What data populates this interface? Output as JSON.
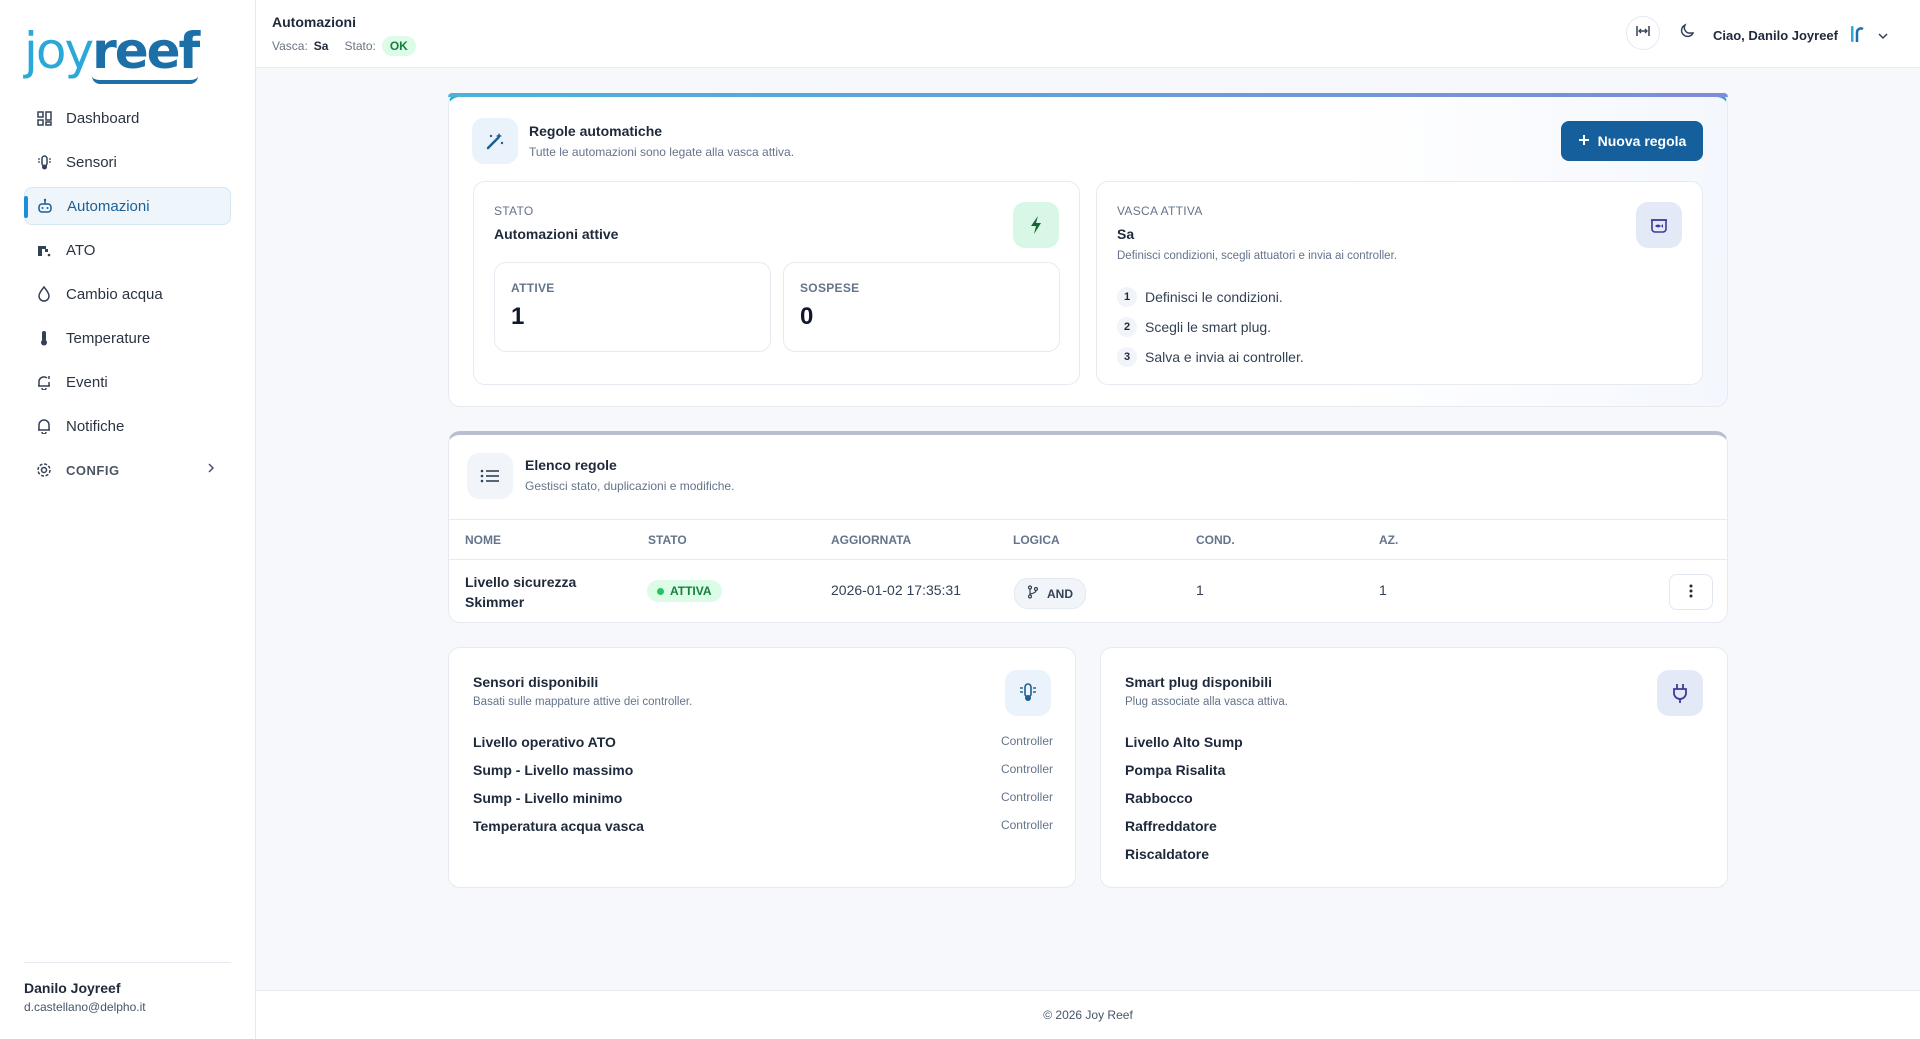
{
  "brand": {
    "logo_left": "joy",
    "logo_right": "reef"
  },
  "sidebar": {
    "items": [
      {
        "label": "Dashboard",
        "icon": "dashboard-icon"
      },
      {
        "label": "Sensori",
        "icon": "sensor-icon"
      },
      {
        "label": "Automazioni",
        "icon": "robot-icon",
        "active": true
      },
      {
        "label": "ATO",
        "icon": "faucet-icon"
      },
      {
        "label": "Cambio acqua",
        "icon": "water-drop-icon"
      },
      {
        "label": "Temperature",
        "icon": "thermometer-icon"
      },
      {
        "label": "Eventi",
        "icon": "bell-alert-icon"
      },
      {
        "label": "Notifiche",
        "icon": "bell-icon"
      },
      {
        "label": "CONFIG",
        "icon": "gear-icon"
      }
    ],
    "user": {
      "name": "Danilo Joyreef",
      "email": "d.castellano@delpho.it"
    }
  },
  "header": {
    "title": "Automazioni",
    "vasca_label": "Vasca:",
    "vasca_value": "Sa",
    "stato_label": "Stato:",
    "stato_value": "OK",
    "greeting": "Ciao, Danilo Joyreef"
  },
  "rules_card": {
    "title": "Regole automatiche",
    "subtitle": "Tutte le automazioni sono legate alla vasca attiva.",
    "new_button": "Nuova regola",
    "status": {
      "label": "STATO",
      "value": "Automazioni attive",
      "active_label": "ATTIVE",
      "active_count": "1",
      "suspended_label": "SOSPESE",
      "suspended_count": "0"
    },
    "vasca": {
      "label": "VASCA ATTIVA",
      "name": "Sa",
      "description": "Definisci condizioni, scegli attuatori e invia ai controller.",
      "steps": [
        {
          "n": "1",
          "text": "Definisci le condizioni."
        },
        {
          "n": "2",
          "text": "Scegli le smart plug."
        },
        {
          "n": "3",
          "text": "Salva e invia ai controller."
        }
      ]
    }
  },
  "rules_list": {
    "title": "Elenco regole",
    "subtitle": "Gestisci stato, duplicazioni e modifiche.",
    "columns": [
      "NOME",
      "STATO",
      "AGGIORNATA",
      "LOGICA",
      "COND.",
      "AZ."
    ],
    "rows": [
      {
        "name_line1": "Livello sicurezza",
        "name_line2": "Skimmer",
        "status": "ATTIVA",
        "updated": "2026-01-02 17:35:31",
        "logic": "AND",
        "cond": "1",
        "az": "1"
      }
    ]
  },
  "sensors": {
    "title": "Sensori disponibili",
    "subtitle": "Basati sulle mappature attive dei controller.",
    "items": [
      {
        "name": "Livello operativo ATO",
        "source": "Controller"
      },
      {
        "name": "Sump - Livello massimo",
        "source": "Controller"
      },
      {
        "name": "Sump - Livello minimo",
        "source": "Controller"
      },
      {
        "name": "Temperatura acqua vasca",
        "source": "Controller"
      }
    ]
  },
  "plugs": {
    "title": "Smart plug disponibili",
    "subtitle": "Plug associate alla vasca attiva.",
    "items": [
      "Livello Alto Sump",
      "Pompa Risalita",
      "Rabbocco",
      "Raffreddatore",
      "Riscaldatore"
    ]
  },
  "footer": {
    "text": "© 2026 Joy Reef"
  },
  "colors": {
    "primary": "#145f9c",
    "accent": "#2aa8d8",
    "success": "#22c55e"
  }
}
